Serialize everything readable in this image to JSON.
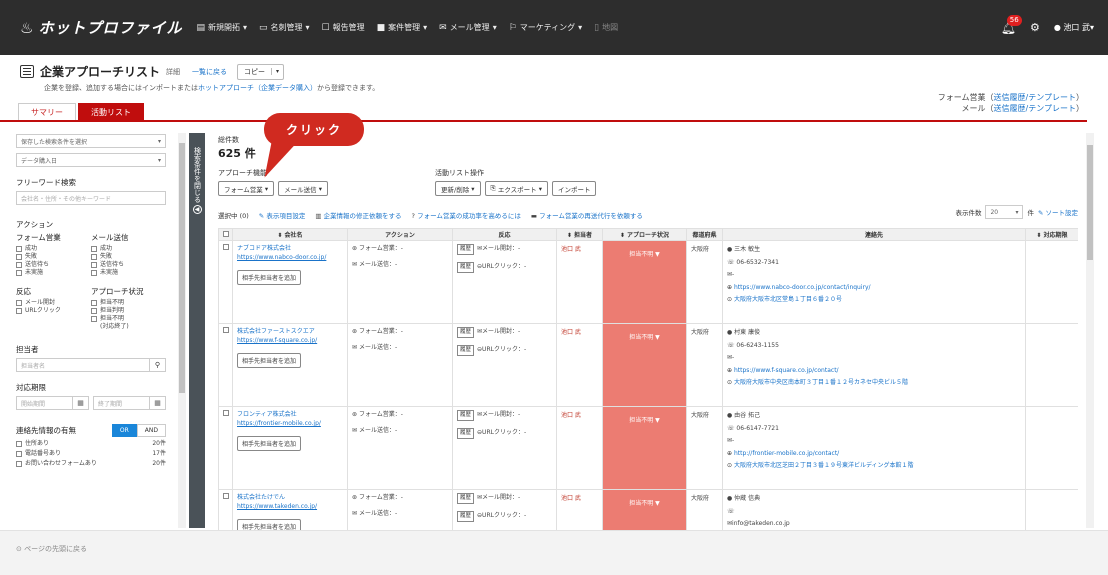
{
  "nav": {
    "logo": "ホットプロファイル",
    "items": [
      {
        "icon": "▤",
        "label": "新規開拓",
        "caret": "▾"
      },
      {
        "icon": "▭",
        "label": "名刺管理",
        "caret": "▾"
      },
      {
        "icon": "☐",
        "label": "報告管理",
        "caret": ""
      },
      {
        "icon": "■",
        "label": "案件管理",
        "caret": "▾"
      },
      {
        "icon": "✉",
        "label": "メール管理",
        "caret": "▾"
      },
      {
        "icon": "⚐",
        "label": "マーケティング",
        "caret": "▾"
      },
      {
        "icon": "▯",
        "label": "地図",
        "caret": ""
      }
    ],
    "notif_count": "56",
    "user": "池口 武",
    "user_caret": "▾"
  },
  "page": {
    "title": "企業アプローチリスト",
    "detail": "詳細",
    "back": "一覧に戻る",
    "copy": "コピー",
    "desc_prefix": "企業を登録、追加する場合にはインポートまたは",
    "desc_link": "ホットアプローチ（企業データ購入）",
    "desc_suffix": "から登録できます。",
    "form_label": "フォーム営業（",
    "form_link": "送信履歴/テンプレート",
    "mail_label": "メール（",
    "mail_link": "送信履歴/テンプレート",
    "close_paren": "）"
  },
  "tabs": {
    "summary": "サマリー",
    "activity": "活動リスト"
  },
  "sidebar": {
    "saved_cond": "保存した検索条件を選択",
    "sort_field": "データ購入日",
    "freeword_label": "フリーワード検索",
    "freeword_placeholder": "会社名・住所・その他キーワード",
    "action_label": "アクション",
    "form_label": "フォーム営業",
    "mail_label": "メール送信",
    "form_opts": [
      "成功",
      "失敗",
      "送信待ち",
      "未実施"
    ],
    "mail_opts": [
      "成功",
      "失敗",
      "送信待ち",
      "未実施"
    ],
    "reaction_label": "反応",
    "approach_label": "アプローチ状況",
    "reaction_opts": [
      "メール開封",
      "URLクリック"
    ],
    "approach_opts": [
      "担当不明",
      "担当判明",
      "担当不明",
      "(対応終了)"
    ],
    "owner_label": "担当者",
    "owner_placeholder": "担当者名",
    "deadline_label": "対応期限",
    "start_placeholder": "開始期間",
    "end_placeholder": "終了期間",
    "contact_label": "連絡先情報の有無",
    "or": "OR",
    "and": "AND",
    "contact_opts": [
      {
        "label": "住所あり",
        "count": "20件"
      },
      {
        "label": "電話番号あり",
        "count": "17件"
      },
      {
        "label": "お問い合わせフォームあり",
        "count": "20件"
      }
    ],
    "collapse": "検索条件を閉じる"
  },
  "main": {
    "total_label": "総件数",
    "total": "625 件",
    "approach_label": "アプローチ機能",
    "form_btn": "フォーム営業",
    "mail_btn": "メール送信",
    "activity_ops": "活動リスト操作",
    "update_btn": "更新/削除",
    "export_btn": "エクスポート",
    "import_btn": "インポート",
    "selected": "選択中 (0)",
    "display_settings": "表示項目設定",
    "links": [
      "企業情報の修正依頼をする",
      "フォーム営業の成功率を高めるには",
      "フォーム営業の再送代行を依頼する"
    ],
    "per_page_label": "表示件数",
    "per_page": "20",
    "per_page_unit": "件",
    "sort_settings": "ソート設定",
    "callout": "クリック"
  },
  "table": {
    "headers": [
      "会社名",
      "アクション",
      "反応",
      "担当者",
      "アプローチ状況",
      "都道府県",
      "連絡先",
      "対応期限"
    ],
    "add_contact": "相手先担当者を追加",
    "form_action": "フォーム営業：-",
    "mail_action": "メール送信：-",
    "history": "履歴",
    "mail_open": "メール開封：-",
    "url_click": "URLクリック：-",
    "status": "担当不明",
    "rows": [
      {
        "company": "ナブコドア株式会社",
        "url": "https://www.nabco-door.co.jp/",
        "owner": "池口 武",
        "pref": "大阪府",
        "person": "三木 敏生",
        "tel": "06-6532-7341",
        "mail": "-",
        "site": "https://www.nabco-door.co.jp/contact/inquiry/",
        "addr": "大阪府大阪市北区堂島１丁目６番２０号"
      },
      {
        "company": "株式会社ファーストスクエア",
        "url": "https://www.f-square.co.jp/",
        "owner": "池口 武",
        "pref": "大阪府",
        "person": "村東 康俊",
        "tel": "06-6243-1155",
        "mail": "-",
        "site": "https://www.f-square.co.jp/contact/",
        "addr": "大阪府大阪市中央区南本町３丁目１番１２号カネセ中央ビル５階"
      },
      {
        "company": "フロンティア株式会社",
        "url": "https://frontier-mobile.co.jp/",
        "owner": "池口 武",
        "pref": "大阪府",
        "person": "由谷 拓己",
        "tel": "06-6147-7721",
        "mail": "-",
        "site": "http://frontier-mobile.co.jp/contact/",
        "addr": "大阪府大阪市北区芝田２丁目３番１９号東洋ビルディング本館１階"
      },
      {
        "company": "株式会社たけでん",
        "url": "https://www.takeden.co.jp/",
        "owner": "池口 武",
        "pref": "大阪府",
        "person": "仲蔵 信典",
        "tel": "",
        "mail": "info@takeden.co.jp",
        "site": "",
        "addr": ""
      }
    ]
  },
  "footer": {
    "to_top": "ページの先頭に戻る"
  }
}
